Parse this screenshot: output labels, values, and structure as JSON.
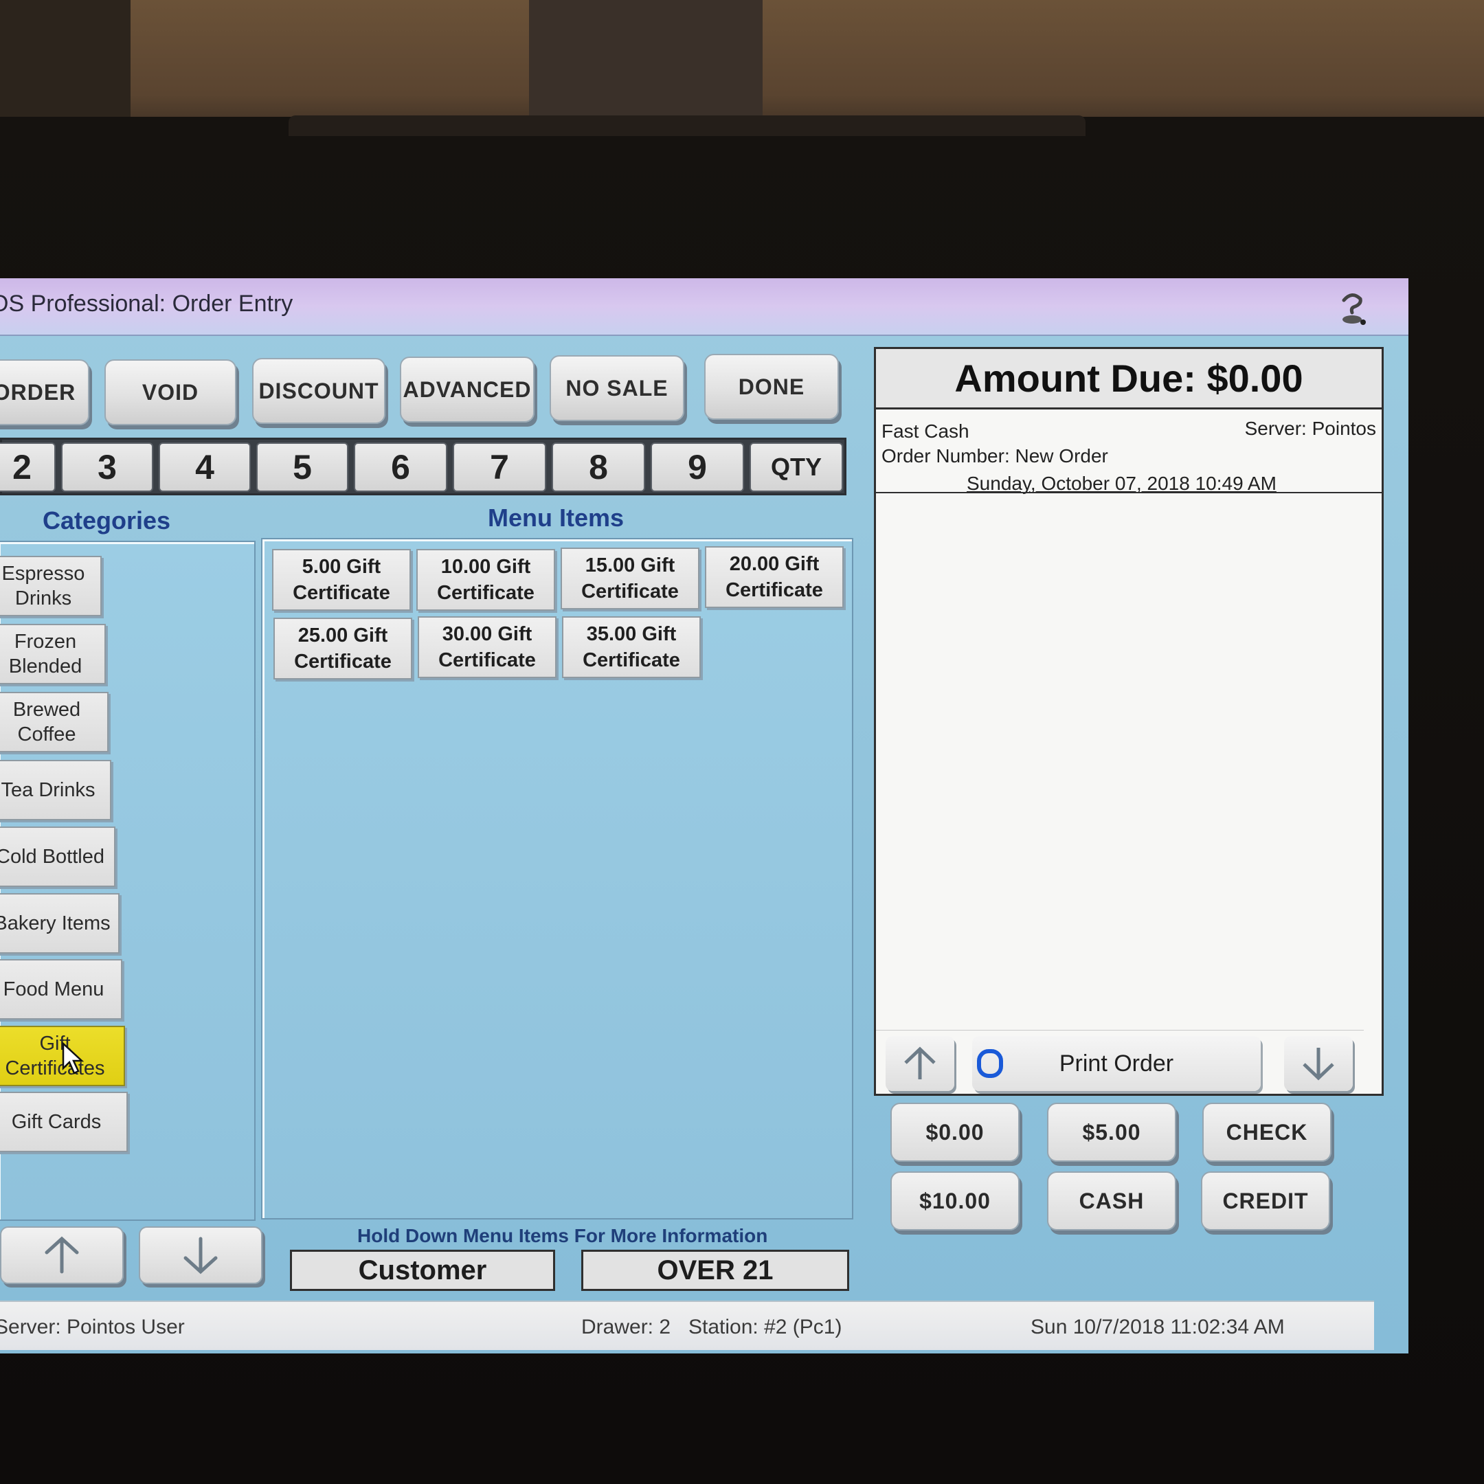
{
  "window": {
    "title": "OS Professional: Order Entry"
  },
  "toolbar": {
    "buttons": [
      "ORDER",
      "VOID",
      "DISCOUNT",
      "ADVANCED",
      "NO SALE",
      "DONE"
    ]
  },
  "keypad": {
    "keys": [
      "2",
      "3",
      "4",
      "5",
      "6",
      "7",
      "8",
      "9",
      "QTY"
    ]
  },
  "categories": {
    "heading": "Categories",
    "items": [
      "Espresso Drinks",
      "Frozen Blended",
      "Brewed Coffee",
      "Tea Drinks",
      "Cold Bottled",
      "Bakery Items",
      "Food Menu",
      "Gift Certificates",
      "Gift Cards"
    ],
    "selected": "Gift Certificates"
  },
  "menu": {
    "heading": "Menu Items",
    "items": [
      "5.00 Gift Certificate",
      "10.00 Gift Certificate",
      "15.00 Gift Certificate",
      "20.00 Gift Certificate",
      "25.00 Gift Certificate",
      "30.00 Gift Certificate",
      "35.00 Gift Certificate"
    ],
    "hint": "Hold Down Menu Items For More Information"
  },
  "fields": {
    "customer": "Customer",
    "age_check": "OVER 21"
  },
  "order": {
    "amount_due": "Amount Due: $0.00",
    "order_type": "Fast Cash",
    "server": "Server: Pointos",
    "order_number": "Order Number: New Order",
    "date": "Sunday, October 07, 2018 10:49 AM",
    "print_label": "Print Order"
  },
  "payment": {
    "buttons": [
      "$0.00",
      "$5.00",
      "CHECK",
      "$10.00",
      "CASH",
      "CREDIT"
    ]
  },
  "status": {
    "server": "Server: Pointos User",
    "drawer": "Drawer: 2",
    "station": "Station: #2 (Pc1)",
    "datetime": "Sun 10/7/2018 11:02:34 AM"
  },
  "colors": {
    "screen_bg": "#9ccbe0",
    "selected_category": "#e8da22",
    "heading_blue": "#1f3f8a"
  }
}
